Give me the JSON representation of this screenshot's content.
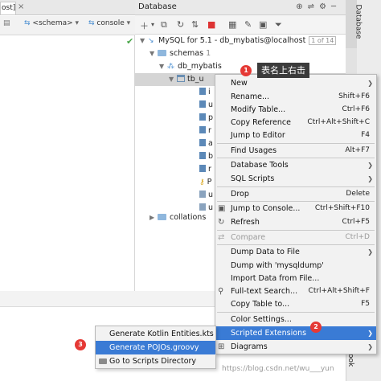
{
  "editor": {
    "tab_label": "ost]",
    "schema_select": "<schema>",
    "console_select": "console"
  },
  "database": {
    "title": "Database",
    "datasource": "MySQL for 5.1 - db_mybatis@localhost",
    "datasource_count": "1 of 14",
    "schemas_label": "schemas",
    "schemas_count": "1",
    "db_name": "db_mybatis",
    "table_name": "tb_u",
    "collations_label": "collations",
    "column_stubs": [
      "i",
      "u",
      "p",
      "r",
      "a",
      "b",
      "r",
      "P",
      "u",
      "u"
    ]
  },
  "side": {
    "db_tab": "Database",
    "book_tab": "Book"
  },
  "annotation": {
    "badge1": "1",
    "tooltip": "表名上右击",
    "badge2": "2",
    "badge3": "3"
  },
  "context_menu": {
    "items": [
      {
        "label": "New",
        "shortcut": "",
        "submenu": true
      },
      {
        "label": "Rename...",
        "shortcut": "Shift+F6"
      },
      {
        "label": "Modify Table...",
        "shortcut": "Ctrl+F6"
      },
      {
        "label": "Copy Reference",
        "shortcut": "Ctrl+Alt+Shift+C"
      },
      {
        "label": "Jump to Editor",
        "shortcut": "F4"
      },
      {
        "label": "Find Usages",
        "shortcut": "Alt+F7"
      },
      {
        "label": "Database Tools",
        "shortcut": "",
        "submenu": true
      },
      {
        "label": "SQL Scripts",
        "shortcut": "",
        "submenu": true
      },
      {
        "label": "Drop",
        "shortcut": "Delete"
      },
      {
        "label": "Jump to Console...",
        "shortcut": "Ctrl+Shift+F10"
      },
      {
        "label": "Refresh",
        "shortcut": "Ctrl+F5"
      },
      {
        "label": "Compare",
        "shortcut": "Ctrl+D"
      },
      {
        "label": "Dump Data to File",
        "shortcut": "",
        "submenu": true
      },
      {
        "label": "Dump with 'mysqldump'",
        "shortcut": ""
      },
      {
        "label": "Import Data from File...",
        "shortcut": ""
      },
      {
        "label": "Full-text Search...",
        "shortcut": "Ctrl+Alt+Shift+F"
      },
      {
        "label": "Copy Table to...",
        "shortcut": "F5"
      },
      {
        "label": "Color Settings...",
        "shortcut": ""
      },
      {
        "label": "Scripted Extensions",
        "shortcut": "",
        "submenu": true
      },
      {
        "label": "Diagrams",
        "shortcut": "",
        "submenu": true
      }
    ]
  },
  "sub_menu": {
    "items": [
      {
        "label": "Generate Kotlin Entities.kts"
      },
      {
        "label": "Generate POJOs.groovy"
      },
      {
        "label": "Go to Scripts Directory"
      }
    ]
  },
  "watermark": "https://blog.csdn.net/wu___yun"
}
